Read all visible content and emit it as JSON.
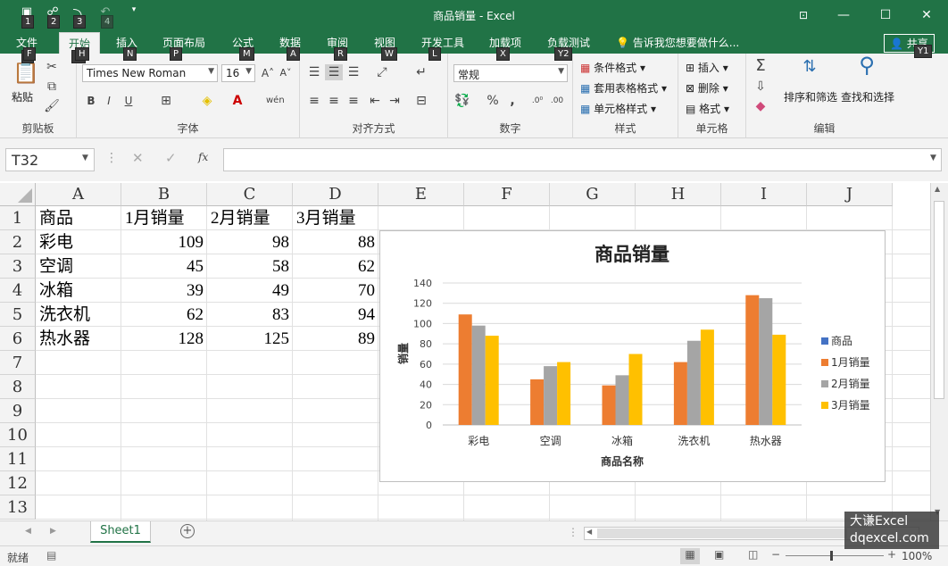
{
  "window": {
    "title": "商品销量 - Excel"
  },
  "qat": {
    "keytips": [
      "1",
      "2",
      "3",
      "4"
    ]
  },
  "tabs": [
    {
      "label": "文件",
      "key": "F",
      "x": 18
    },
    {
      "label": "开始",
      "key": "H",
      "x": 76,
      "active": true
    },
    {
      "label": "插入",
      "key": "N",
      "x": 130
    },
    {
      "label": "页面布局",
      "key": "P",
      "x": 182
    },
    {
      "label": "公式",
      "key": "M",
      "x": 260
    },
    {
      "label": "数据",
      "key": "A",
      "x": 313
    },
    {
      "label": "审阅",
      "key": "R",
      "x": 366
    },
    {
      "label": "视图",
      "key": "W",
      "x": 419
    },
    {
      "label": "开发工具",
      "key": "L",
      "x": 472
    },
    {
      "label": "加载项",
      "key": "X",
      "x": 548
    },
    {
      "label": "负载测试",
      "key": "Y2",
      "x": 613
    }
  ],
  "tellme": "告诉我您想要做什么...",
  "share": {
    "label": "共享",
    "key": "Y1"
  },
  "ribbon": {
    "clipboard": {
      "label": "剪贴板",
      "paste": "粘贴"
    },
    "font": {
      "label": "字体",
      "name": "Times New Roman",
      "size": "16"
    },
    "alignment": {
      "label": "对齐方式"
    },
    "number": {
      "label": "数字",
      "format": "常规"
    },
    "styles": {
      "label": "样式",
      "items": [
        "条件格式",
        "套用表格格式",
        "单元格样式"
      ]
    },
    "cells": {
      "label": "单元格",
      "items": [
        "插入",
        "删除",
        "格式"
      ]
    },
    "editing": {
      "label": "编辑",
      "sort": "排序和筛选",
      "find": "查找和选择"
    }
  },
  "formula_bar": {
    "namebox": "T32",
    "fx": "fx",
    "value": ""
  },
  "columns": [
    "A",
    "B",
    "C",
    "D",
    "E",
    "F",
    "G",
    "H",
    "I",
    "J"
  ],
  "rows": [
    "1",
    "2",
    "3",
    "4",
    "5",
    "6",
    "7",
    "8",
    "9",
    "10",
    "11",
    "12",
    "13"
  ],
  "cells": {
    "header": [
      "商品",
      "1月销量",
      "2月销量",
      "3月销量"
    ],
    "data": [
      [
        "彩电",
        "109",
        "98",
        "88"
      ],
      [
        "空调",
        "45",
        "58",
        "62"
      ],
      [
        "冰箱",
        "39",
        "49",
        "70"
      ],
      [
        "洗衣机",
        "62",
        "83",
        "94"
      ],
      [
        "热水器",
        "128",
        "125",
        "89"
      ]
    ]
  },
  "chart_data": {
    "type": "bar",
    "title": "商品销量",
    "xlabel": "商品名称",
    "ylabel": "销量",
    "categories": [
      "彩电",
      "空调",
      "冰箱",
      "洗衣机",
      "热水器"
    ],
    "ylim": [
      0,
      140
    ],
    "yticks": [
      "0",
      "20",
      "40",
      "60",
      "80",
      "100",
      "120",
      "140"
    ],
    "series": [
      {
        "name": "商品",
        "values": [],
        "color": "#4472c4"
      },
      {
        "name": "1月销量",
        "values": [
          109,
          45,
          39,
          62,
          128
        ],
        "color": "#ed7d31"
      },
      {
        "name": "2月销量",
        "values": [
          98,
          58,
          49,
          83,
          125
        ],
        "color": "#a5a5a5"
      },
      {
        "name": "3月销量",
        "values": [
          88,
          62,
          70,
          94,
          89
        ],
        "color": "#ffc000"
      }
    ],
    "legend": "right",
    "grid": true
  },
  "sheets": [
    {
      "label": "Sheet1",
      "active": true
    }
  ],
  "status": {
    "ready": "就绪",
    "zoom": "100%"
  },
  "watermark": {
    "line1": "大谦Excel",
    "line2": "dqexcel.com"
  }
}
